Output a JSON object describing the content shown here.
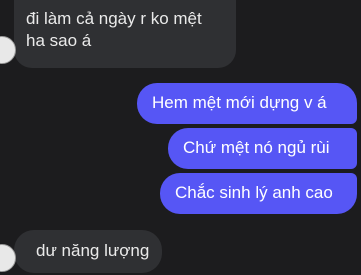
{
  "messages": [
    {
      "side": "in",
      "lines": [
        "đi làm cả ngày r ko mệt",
        "ha sao á"
      ]
    },
    {
      "side": "out",
      "lines": [
        "Hem mệt mới dựng v á"
      ]
    },
    {
      "side": "out",
      "lines": [
        "Chứ mệt nó ngủ rùi"
      ]
    },
    {
      "side": "out",
      "lines": [
        "Chắc sinh lý anh cao"
      ]
    },
    {
      "side": "in",
      "lines": [
        "dư năng lượng"
      ]
    }
  ],
  "colors": {
    "background": "#1c1c1e",
    "incoming_bubble": "#2f3033",
    "outgoing_bubble": "#5656f5"
  }
}
